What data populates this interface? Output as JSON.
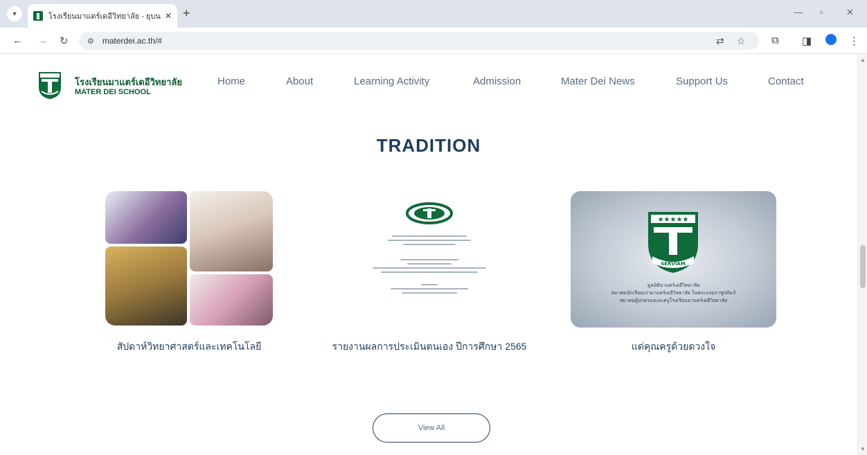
{
  "browser": {
    "tab_title": "โรงเรียนมาแตร์เดอีวิทยาลัย - ยุบนะ",
    "url": "materdei.ac.th/#"
  },
  "site": {
    "brand_thai": "โรงเรียนมาแตร์เดอีวิทยาลัย",
    "brand_english": "MATER DEI SCHOOL",
    "nav": [
      {
        "label": "Home"
      },
      {
        "label": "About"
      },
      {
        "label": "Learning Activity"
      },
      {
        "label": "Admission"
      },
      {
        "label": "Mater Dei News"
      },
      {
        "label": "Support Us"
      },
      {
        "label": "Contact"
      }
    ]
  },
  "section": {
    "title": "TRADITION",
    "cards": [
      {
        "caption": "สัปดาห์วิทยาศาสตร์และเทคโนโลยี"
      },
      {
        "caption": "รายงานผลการประเมินตนเอง ปีการศึกษา 2565"
      },
      {
        "caption": "แด่คุณครูด้วยดวงใจ"
      }
    ],
    "tribute_lines": [
      "มูลนิธิมาแตร์เดอีวิทยาลัย",
      "สมาคมนักเรียนเก่ามาแตร์เดอีวิทยาลัย ในพระบรมราชูปถัมภ์",
      "สมาคมผู้ปกครองและครูโรงเรียนมาแตร์เดอีวิทยาลัย"
    ],
    "crest_motto": "SERVIAM",
    "view_all_label": "View All"
  },
  "colors": {
    "brand_green": "#0f5a33",
    "heading_navy": "#1f3c5e",
    "nav_text": "#5b6a84"
  }
}
